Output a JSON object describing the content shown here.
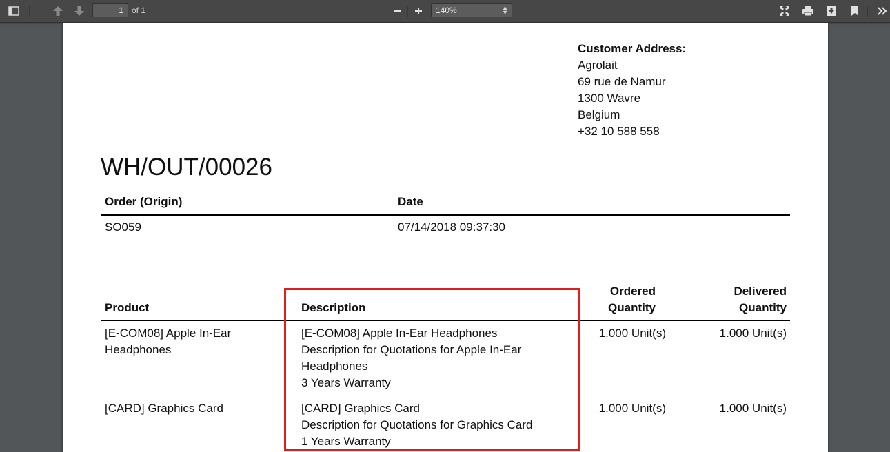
{
  "toolbar": {
    "page_number": "1",
    "page_count": "of 1",
    "zoom": "140%",
    "icons": {
      "sidebar_toggle": "sidebar-toggle-icon",
      "previous_page": "arrow-up-icon",
      "next_page": "arrow-down-icon",
      "zoom_out": "minus-icon",
      "zoom_in": "plus-icon",
      "presentation": "fullscreen-icon",
      "print": "print-icon",
      "download": "download-icon",
      "bookmark": "bookmark-icon",
      "tools": "double-chevron-right-icon"
    }
  },
  "document": {
    "customer_address": {
      "heading": "Customer Address:",
      "lines": [
        "Agrolait",
        "69 rue de Namur",
        "1300 Wavre",
        "Belgium",
        "+32 10 588 558"
      ]
    },
    "title": "WH/OUT/00026",
    "info_table": {
      "headers": [
        "Order (Origin)",
        "Date"
      ],
      "row": [
        "SO059",
        "07/14/2018 09:37:30"
      ]
    },
    "lines_table": {
      "headers": {
        "product": "Product",
        "description": "Description",
        "ordered_line1": "Ordered",
        "ordered_line2": "Quantity",
        "delivered_line1": "Delivered",
        "delivered_line2": "Quantity"
      },
      "rows": [
        {
          "product_line1": "[E-COM08] Apple In-Ear",
          "product_line2": "Headphones",
          "description": [
            "[E-COM08] Apple In-Ear Headphones",
            "Description for Quotations for Apple In-Ear",
            "Headphones",
            "3 Years Warranty"
          ],
          "ordered": "1.000 Unit(s)",
          "delivered": "1.000 Unit(s)"
        },
        {
          "product_line1": "[CARD] Graphics Card",
          "description": [
            "[CARD] Graphics Card",
            "Description for Quotations for Graphics Card",
            "1 Years Warranty"
          ],
          "ordered": "1.000 Unit(s)",
          "delivered": "1.000 Unit(s)"
        }
      ]
    },
    "highlight_color": "#e51c1c"
  }
}
